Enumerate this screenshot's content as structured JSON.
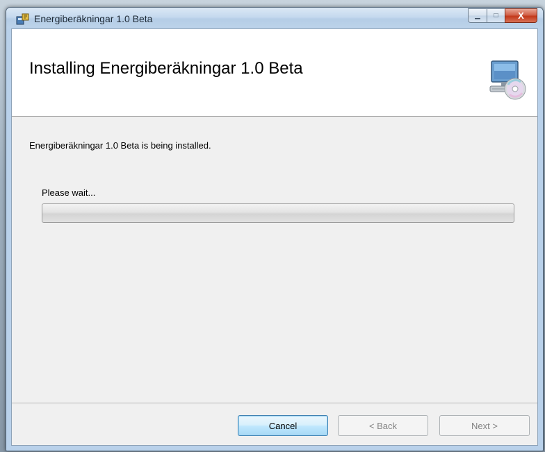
{
  "window": {
    "title": "Energiberäkningar 1.0 Beta",
    "caption_buttons": {
      "minimize_glyph": "▁",
      "maximize_glyph": "□",
      "close_glyph": "X"
    }
  },
  "header": {
    "title": "Installing Energiberäkningar 1.0 Beta",
    "icon": "computer-disc-icon"
  },
  "body": {
    "status_text": "Energiberäkningar 1.0 Beta is being installed.",
    "wait_label": "Please wait...",
    "progress": 0
  },
  "footer": {
    "cancel_label": "Cancel",
    "back_label": "< Back",
    "next_label": "Next >"
  },
  "colors": {
    "titlebar": "#c5d9ee",
    "client_bg": "#f0f0f0",
    "close_button": "#c3391b",
    "focus_button": "#3c7fb1"
  }
}
